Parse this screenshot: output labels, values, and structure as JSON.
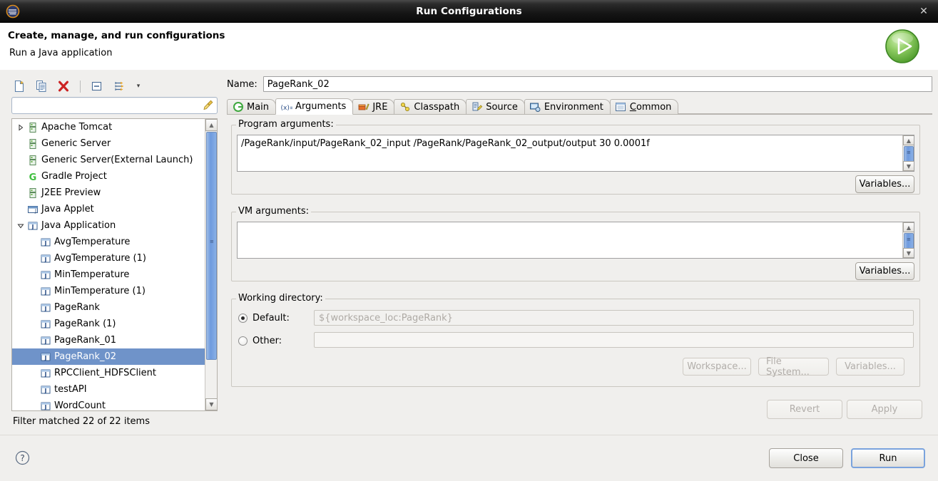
{
  "window": {
    "title": "Run Configurations",
    "close_label": "✕",
    "app_icon": "eclipse-icon"
  },
  "header": {
    "title": "Create, manage, and run configurations",
    "subtitle": "Run a Java application",
    "icon": "run-green-play-icon"
  },
  "left_panel": {
    "toolbar": [
      {
        "name": "new-configuration-button",
        "icon": "new-document-icon"
      },
      {
        "name": "duplicate-configuration-button",
        "icon": "copy-icon"
      },
      {
        "name": "delete-configuration-button",
        "icon": "delete-red-x-icon"
      },
      {
        "name": "collapse-all-button",
        "icon": "collapse-all-icon"
      },
      {
        "name": "filter-configurations-button",
        "icon": "filter-arrows-icon"
      },
      {
        "name": "view-menu-button",
        "icon": "chevron-down-icon"
      }
    ],
    "filter": {
      "value": "",
      "placeholder": "",
      "clear_icon": "broom-icon"
    },
    "tree": [
      {
        "label": "Apache Tomcat",
        "icon": "server-icon",
        "indent": 0,
        "twisty": "collapsed",
        "selected": false
      },
      {
        "label": "Generic Server",
        "icon": "server-icon",
        "indent": 0,
        "twisty": "none",
        "selected": false
      },
      {
        "label": "Generic Server(External Launch)",
        "icon": "server-icon",
        "indent": 0,
        "twisty": "none",
        "selected": false
      },
      {
        "label": "Gradle Project",
        "icon": "gradle-icon",
        "indent": 0,
        "twisty": "none",
        "selected": false
      },
      {
        "label": "J2EE Preview",
        "icon": "server-icon",
        "indent": 0,
        "twisty": "none",
        "selected": false
      },
      {
        "label": "Java Applet",
        "icon": "java-applet-icon",
        "indent": 0,
        "twisty": "none",
        "selected": false
      },
      {
        "label": "Java Application",
        "icon": "java-application-icon",
        "indent": 0,
        "twisty": "expanded",
        "selected": false
      },
      {
        "label": "AvgTemperature",
        "icon": "java-launch-icon",
        "indent": 1,
        "twisty": "none",
        "selected": false
      },
      {
        "label": "AvgTemperature (1)",
        "icon": "java-launch-icon",
        "indent": 1,
        "twisty": "none",
        "selected": false
      },
      {
        "label": "MinTemperature",
        "icon": "java-launch-icon",
        "indent": 1,
        "twisty": "none",
        "selected": false
      },
      {
        "label": "MinTemperature (1)",
        "icon": "java-launch-icon",
        "indent": 1,
        "twisty": "none",
        "selected": false
      },
      {
        "label": "PageRank",
        "icon": "java-launch-icon",
        "indent": 1,
        "twisty": "none",
        "selected": false
      },
      {
        "label": "PageRank (1)",
        "icon": "java-launch-icon",
        "indent": 1,
        "twisty": "none",
        "selected": false
      },
      {
        "label": "PageRank_01",
        "icon": "java-launch-icon",
        "indent": 1,
        "twisty": "none",
        "selected": false
      },
      {
        "label": "PageRank_02",
        "icon": "java-launch-icon",
        "indent": 1,
        "twisty": "none",
        "selected": true
      },
      {
        "label": "RPCClient_HDFSClient",
        "icon": "java-launch-icon",
        "indent": 1,
        "twisty": "none",
        "selected": false
      },
      {
        "label": "testAPI",
        "icon": "java-launch-icon",
        "indent": 1,
        "twisty": "none",
        "selected": false
      },
      {
        "label": "WordCount",
        "icon": "java-launch-icon",
        "indent": 1,
        "twisty": "none",
        "selected": false
      }
    ],
    "status": "Filter matched 22 of 22 items"
  },
  "right_panel": {
    "name_label": "Name:",
    "name_value": "PageRank_02",
    "tabs": [
      {
        "label": "Main",
        "icon": "main-green-circle-icon",
        "active": false
      },
      {
        "label": "Arguments",
        "icon": "arguments-xy-icon",
        "active": true
      },
      {
        "label": "JRE",
        "icon": "jre-icon",
        "active": false
      },
      {
        "label": "Classpath",
        "icon": "classpath-icon",
        "active": false
      },
      {
        "label": "Source",
        "icon": "source-icon",
        "active": false
      },
      {
        "label": "Environment",
        "icon": "environment-icon",
        "active": false
      },
      {
        "label": "Common",
        "icon": "common-icon",
        "active": false
      }
    ],
    "program_arguments": {
      "group_title": "Program arguments:",
      "value": "/PageRank/input/PageRank_02_input /PageRank/PageRank_02_output/output 30 0.0001f",
      "variables_button": "Variables..."
    },
    "vm_arguments": {
      "group_title": "VM arguments:",
      "value": "",
      "variables_button": "Variables..."
    },
    "working_directory": {
      "group_title": "Working directory:",
      "default_label": "Default:",
      "default_selected": true,
      "default_value": "${workspace_loc:PageRank}",
      "other_label": "Other:",
      "other_selected": false,
      "other_value": "",
      "workspace_button": "Workspace...",
      "file_system_button": "File System...",
      "variables_button": "Variables..."
    },
    "revert_button": "Revert",
    "apply_button": "Apply"
  },
  "footer": {
    "help_icon": "help-question-icon",
    "close_button": "Close",
    "run_button": "Run"
  },
  "colors": {
    "selection_blue": "#6f93c9",
    "accent_green": "#5fb03a",
    "titlebar_dark": "#151515",
    "panel_bg": "#f0efed"
  }
}
